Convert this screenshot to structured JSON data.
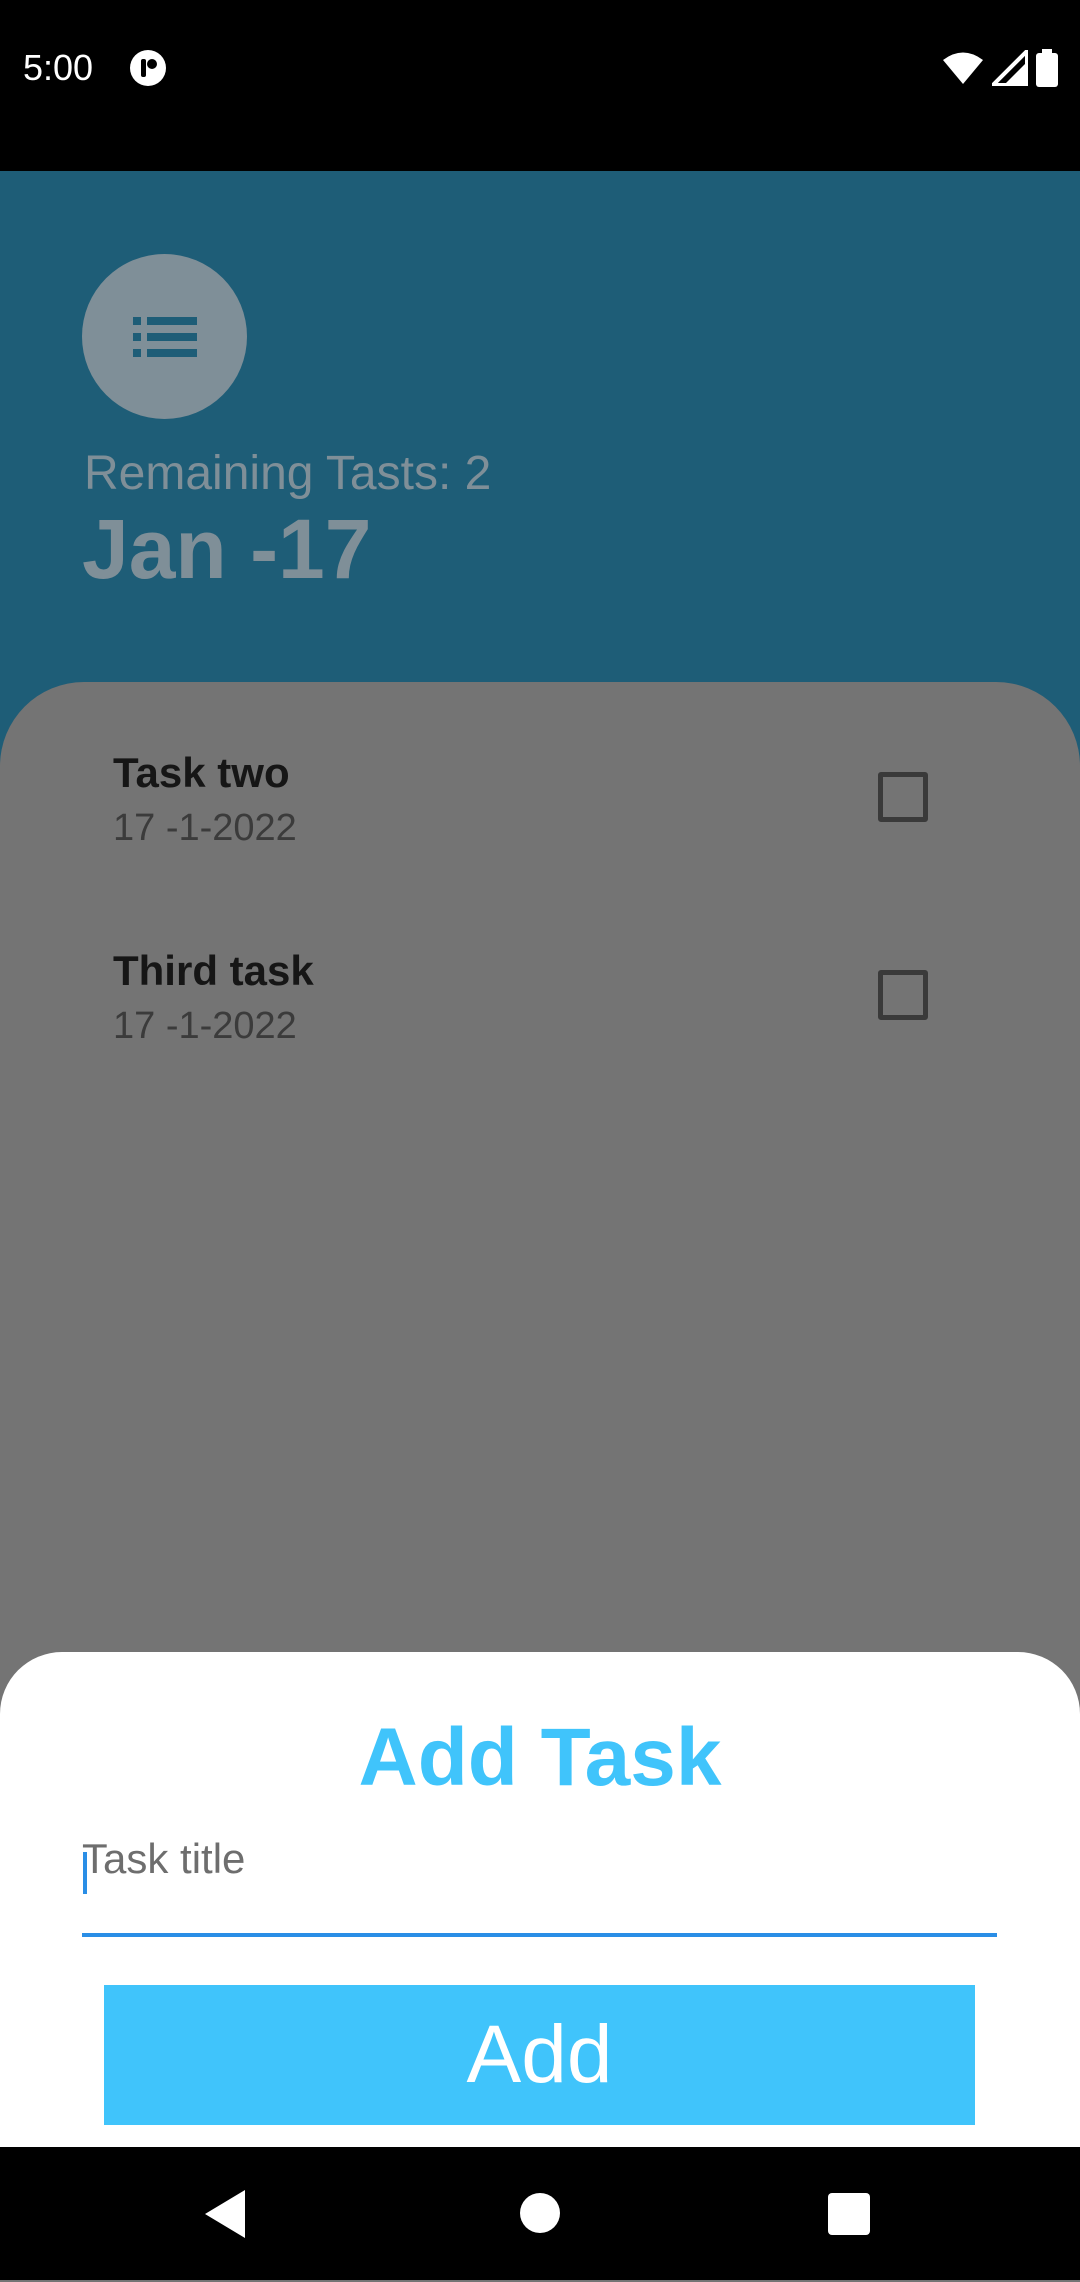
{
  "status_bar": {
    "time": "5:00",
    "app_icon": "notification-app-icon",
    "icons": [
      "wifi-icon",
      "signal-icon",
      "battery-icon"
    ]
  },
  "header": {
    "avatar_icon": "list-icon",
    "remaining_text": "Remaining Tasts: 2",
    "date_title": "Jan -17"
  },
  "tasks": [
    {
      "title": "Task two",
      "date": "17 -1-2022",
      "checked": false
    },
    {
      "title": "Third task",
      "date": "17 -1-2022",
      "checked": false
    }
  ],
  "add_sheet": {
    "title": "Add Task",
    "input_placeholder": "Task title",
    "input_value": "",
    "button_label": "Add"
  },
  "nav_bar": {
    "icons": [
      "back-icon",
      "home-icon",
      "recents-icon"
    ]
  },
  "colors": {
    "header_bg": "#1e5d77",
    "list_bg": "#747474",
    "accent": "#40c4fb",
    "input_underline": "#2a8ee6"
  }
}
